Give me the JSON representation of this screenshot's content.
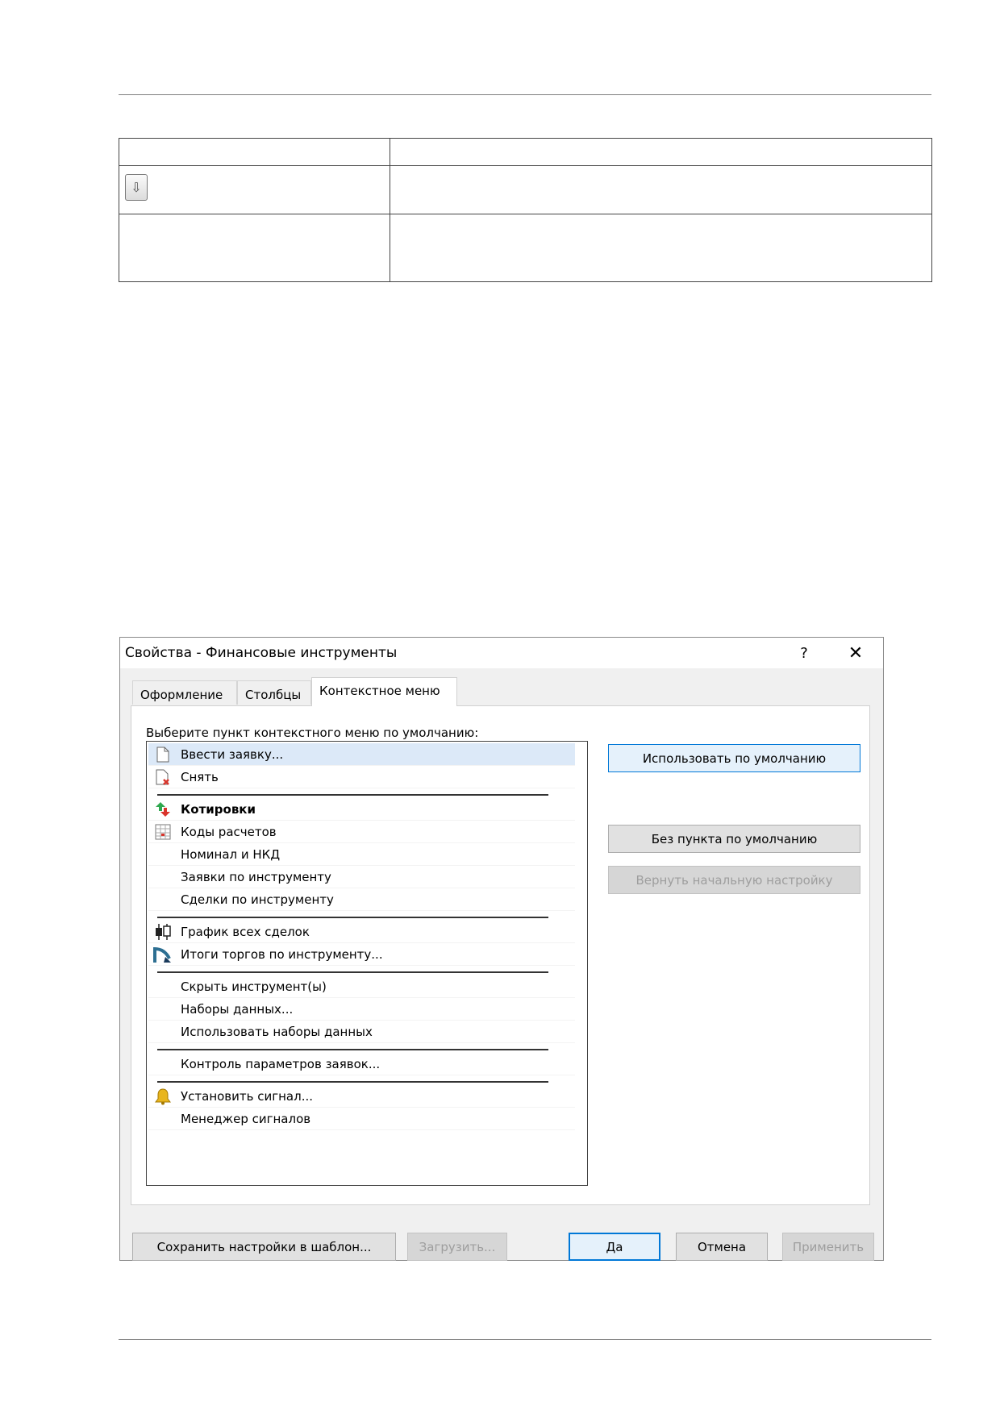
{
  "table": {
    "small_button_icon": "down-arrow-icon",
    "small_button_glyph": "⇩"
  },
  "dialog": {
    "title": "Свойства - Финансовые инструменты",
    "help_glyph": "?",
    "close_glyph": "✕",
    "tabs": [
      "Оформление",
      "Столбцы",
      "Контекстное меню"
    ],
    "active_tab": "Контекстное меню",
    "prompt": "Выберите пункт контекстного меню по умолчанию:",
    "menu_items": [
      {
        "label": "Ввести заявку...",
        "icon": "document-icon",
        "selected": true
      },
      {
        "label": "Снять",
        "icon": "document-delete-icon"
      },
      {
        "label": "Котировки",
        "icon": "quotes-arrows-icon",
        "bold": true
      },
      {
        "label": "Коды расчетов",
        "icon": "table-grid-icon"
      },
      {
        "label": "Номинал и НКД"
      },
      {
        "label": "Заявки по инструменту"
      },
      {
        "label": "Сделки по инструменту"
      },
      {
        "label": "График всех сделок",
        "icon": "candlestick-chart-icon"
      },
      {
        "label": "Итоги торгов по инструменту...",
        "icon": "trading-results-icon"
      },
      {
        "label": "Скрыть инструмент(ы)"
      },
      {
        "label": "Наборы данных..."
      },
      {
        "label": "Использовать наборы данных"
      },
      {
        "label": "Контроль параметров заявок..."
      },
      {
        "label": "Установить сигнал...",
        "icon": "bell-icon"
      },
      {
        "label": "Менеджер сигналов"
      }
    ],
    "side_buttons": {
      "use_default": "Использовать по умолчанию",
      "no_default": "Без пункта по умолчанию",
      "reset": "Вернуть начальную настройку"
    },
    "footer_buttons": {
      "save_template": "Сохранить настройки в шаблон...",
      "load": "Загрузить...",
      "ok": "Да",
      "cancel": "Отмена",
      "apply": "Применить"
    }
  }
}
